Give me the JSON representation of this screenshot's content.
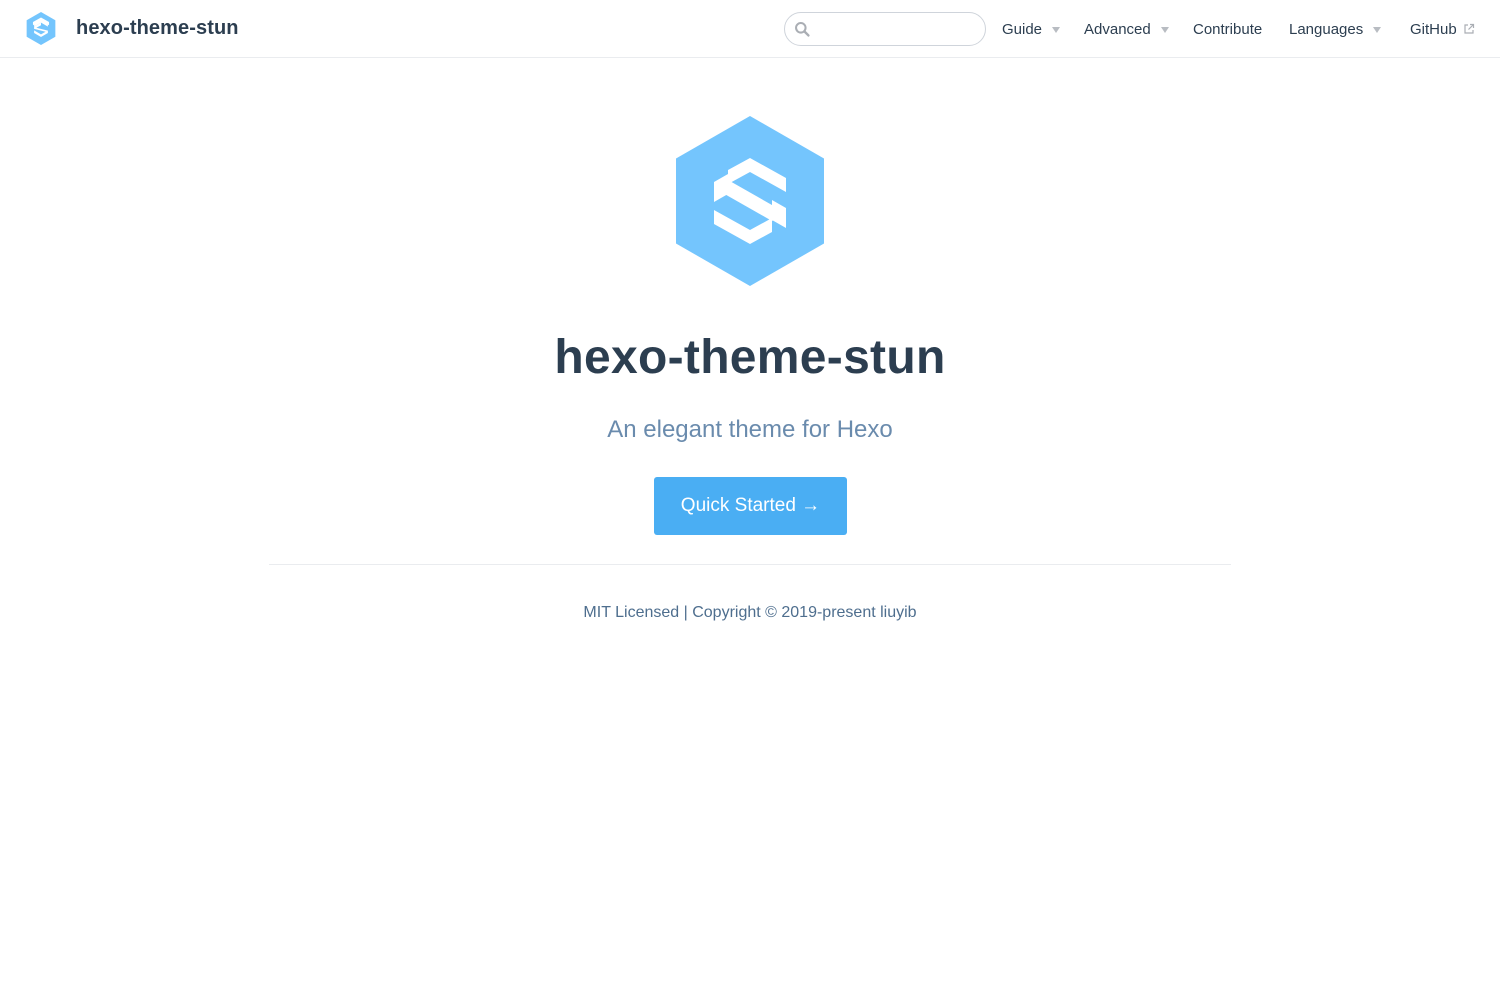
{
  "navbar": {
    "site_title": "hexo-theme-stun",
    "search": {
      "placeholder": "",
      "value": ""
    },
    "items": [
      {
        "label": "Guide",
        "has_dropdown": true
      },
      {
        "label": "Advanced",
        "has_dropdown": true
      },
      {
        "label": "Contribute",
        "has_dropdown": false
      },
      {
        "label": "Languages",
        "has_dropdown": true
      },
      {
        "label": "GitHub",
        "external": true
      }
    ]
  },
  "hero": {
    "title": "hexo-theme-stun",
    "description": "An elegant theme for Hexo",
    "action_label": "Quick Started →"
  },
  "footer": {
    "text": "MIT Licensed | Copyright © 2019-present liuyib"
  },
  "colors": {
    "accent": "#4aaef3",
    "logo": "#74c5fd",
    "text": "#2c3e50",
    "description": "#6a8bad",
    "border": "#eaecef"
  },
  "icons": {
    "logo": "stun-hexagon-logo",
    "search": "search-icon",
    "dropdown": "caret-down-icon",
    "external": "external-link-icon"
  }
}
